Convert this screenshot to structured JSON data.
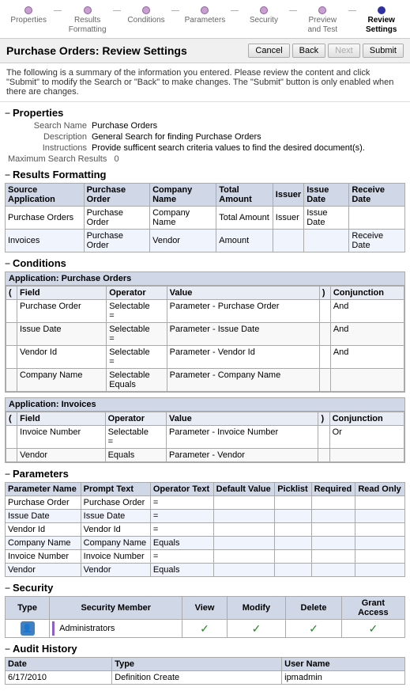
{
  "wizard": {
    "steps": [
      {
        "id": "properties",
        "label": "Properties",
        "active": false
      },
      {
        "id": "results-formatting",
        "label": "Results\nFormatting",
        "active": false
      },
      {
        "id": "conditions",
        "label": "Conditions",
        "active": false
      },
      {
        "id": "parameters",
        "label": "Parameters",
        "active": false
      },
      {
        "id": "security",
        "label": "Security",
        "active": false
      },
      {
        "id": "preview-test",
        "label": "Preview\nand Test",
        "active": false
      },
      {
        "id": "review-settings",
        "label": "Review\nSettings",
        "active": true
      }
    ]
  },
  "page": {
    "title": "Purchase Orders: Review Settings",
    "info_text": "The following is a summary of the information you entered. Please review the content and click \"Submit\" to modify the Search or \"Back\" to make changes. The \"Submit\" button is only enabled when there are changes.",
    "buttons": {
      "cancel": "Cancel",
      "back": "Back",
      "next": "Next",
      "submit": "Submit"
    }
  },
  "properties": {
    "section_label": "Properties",
    "search_name_label": "Search Name",
    "search_name_value": "Purchase Orders",
    "description_label": "Description",
    "description_value": "General Search for finding Purchase Orders",
    "instructions_label": "Instructions",
    "instructions_value": "Provide sufficent search criteria values to find the desired document(s).",
    "max_results_label": "Maximum Search Results",
    "max_results_value": "0"
  },
  "results_formatting": {
    "section_label": "Results Formatting",
    "columns": [
      "Source Application",
      "Purchase Order",
      "Company Name",
      "Total Amount",
      "Issuer",
      "Issue Date",
      "Receive Date"
    ],
    "rows": [
      [
        "Purchase Orders",
        "Purchase Order",
        "Company Name",
        "Total Amount",
        "Issuer",
        "Issue Date",
        ""
      ],
      [
        "Invoices",
        "Purchase Order",
        "Vendor",
        "Amount",
        "",
        "",
        "Receive Date"
      ]
    ]
  },
  "conditions": {
    "section_label": "Conditions",
    "groups": [
      {
        "label": "Application: Purchase Orders",
        "columns": [
          "(",
          "Field",
          "Operator",
          "Value",
          ")",
          "Conjunction"
        ],
        "rows": [
          {
            "paren_open": "",
            "field": "Purchase Order",
            "operator": "Selectable\n=",
            "value": "Parameter - Purchase Order",
            "paren_close": "",
            "conjunction": "And"
          },
          {
            "paren_open": "",
            "field": "Issue Date",
            "operator": "Selectable\n=",
            "value": "Parameter - Issue Date",
            "paren_close": "",
            "conjunction": "And"
          },
          {
            "paren_open": "",
            "field": "Vendor Id",
            "operator": "Selectable\n=",
            "value": "Parameter - Vendor Id",
            "paren_close": "",
            "conjunction": "And"
          },
          {
            "paren_open": "",
            "field": "Company Name",
            "operator": "Selectable\nEquals",
            "value": "Parameter - Company Name",
            "paren_close": "",
            "conjunction": ""
          }
        ]
      },
      {
        "label": "Application: Invoices",
        "columns": [
          "(",
          "Field",
          "Operator",
          "Value",
          ")",
          "Conjunction"
        ],
        "rows": [
          {
            "paren_open": "",
            "field": "Invoice Number",
            "operator": "Selectable\n=",
            "value": "Parameter - Invoice Number",
            "paren_close": "",
            "conjunction": "Or"
          },
          {
            "paren_open": "",
            "field": "Vendor",
            "operator": "Equals",
            "value": "Parameter - Vendor",
            "paren_close": "",
            "conjunction": ""
          }
        ]
      }
    ]
  },
  "parameters": {
    "section_label": "Parameters",
    "columns": [
      "Parameter Name",
      "Prompt Text",
      "Operator Text",
      "Default Value",
      "Picklist",
      "Required",
      "Read Only"
    ],
    "rows": [
      {
        "name": "Purchase Order",
        "prompt": "Purchase Order",
        "operator": "=",
        "default": "",
        "picklist": "",
        "required": "",
        "readonly": ""
      },
      {
        "name": "Issue Date",
        "prompt": "Issue Date",
        "operator": "=",
        "default": "",
        "picklist": "",
        "required": "",
        "readonly": ""
      },
      {
        "name": "Vendor Id",
        "prompt": "Vendor Id",
        "operator": "=",
        "default": "",
        "picklist": "",
        "required": "",
        "readonly": ""
      },
      {
        "name": "Company Name",
        "prompt": "Company Name",
        "operator": "Equals",
        "default": "",
        "picklist": "",
        "required": "",
        "readonly": ""
      },
      {
        "name": "Invoice Number",
        "prompt": "Invoice Number",
        "operator": "=",
        "default": "",
        "picklist": "",
        "required": "",
        "readonly": ""
      },
      {
        "name": "Vendor",
        "prompt": "Vendor",
        "operator": "Equals",
        "default": "",
        "picklist": "",
        "required": "",
        "readonly": ""
      }
    ]
  },
  "security": {
    "section_label": "Security",
    "columns": [
      "Type",
      "Security Member",
      "View",
      "Modify",
      "Delete",
      "Grant\nAccess"
    ],
    "rows": [
      {
        "type": "group",
        "member": "Administrators",
        "view": true,
        "modify": true,
        "delete": true,
        "grant": true
      }
    ]
  },
  "audit": {
    "section_label": "Audit History",
    "columns": [
      "Date",
      "Type",
      "User Name"
    ],
    "rows": [
      {
        "date": "6/17/2010",
        "type": "Definition Create",
        "username": "ipmadmin"
      }
    ]
  }
}
